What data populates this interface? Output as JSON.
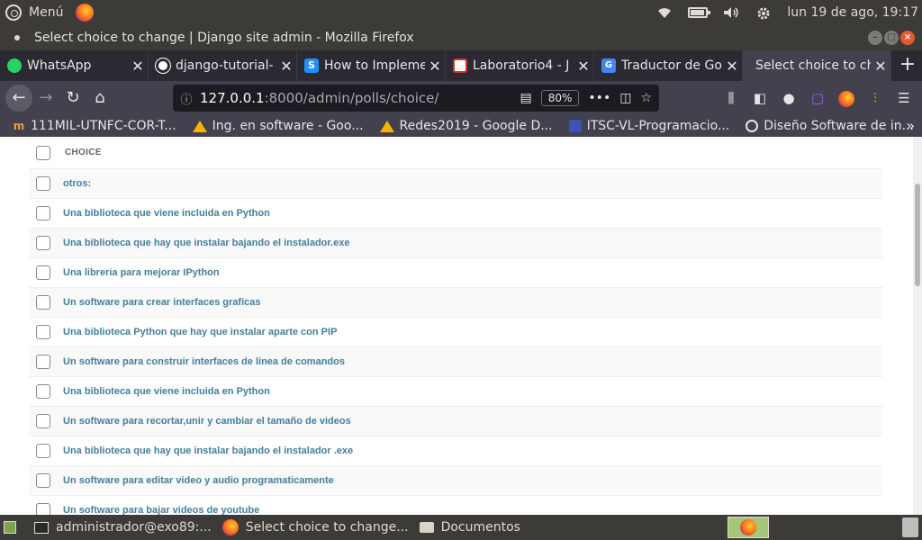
{
  "top_panel": {
    "menu_label": "Menú",
    "clock": "lun 19 de ago, 19:17"
  },
  "window": {
    "title": "Select choice to change | Django site admin - Mozilla Firefox"
  },
  "tabs": [
    {
      "label": "WhatsApp",
      "icon": "whatsapp-icon"
    },
    {
      "label": "django-tutorial-",
      "icon": "github-icon"
    },
    {
      "label": "How to Impleme",
      "icon": "stackoverflow-icon"
    },
    {
      "label": "Laboratorio4 - J",
      "icon": "gmail-icon"
    },
    {
      "label": "Traductor de Go",
      "icon": "google-translate-icon"
    },
    {
      "label": "Select choice to cha",
      "icon": "",
      "active": true
    }
  ],
  "navbar": {
    "url_host": "127.0.0.1",
    "url_path": ":8000/admin/polls/choice/",
    "zoom": "80%"
  },
  "bookmarks": [
    {
      "label": "111MIL-UTNFC-COR-T...",
      "icon": "moodle-icon"
    },
    {
      "label": "Ing. en software - Goo...",
      "icon": "google-drive-icon"
    },
    {
      "label": "Redes2019 - Google D...",
      "icon": "google-drive-icon"
    },
    {
      "label": "ITSC-VL-Programacio...",
      "icon": "classroom-icon"
    },
    {
      "label": "Diseño Software de in...",
      "icon": "globe-icon"
    }
  ],
  "table": {
    "column_header": "CHOICE",
    "rows": [
      "otros:",
      "Una biblioteca que viene incluida en Python",
      "Una biblioteca que hay que instalar bajando el instalador.exe",
      "Una libreria para mejorar IPython",
      "Un software para crear interfaces graficas",
      "Una biblioteca Python que hay que instalar aparte con PIP",
      "Un software para construir interfaces de linea de comandos",
      "Una biblioteca que viene incluida en Python",
      "Un software para recortar,unir y cambiar el tamaño de videos",
      "Una biblioteca que hay que instalar bajando el instalador .exe",
      "Un software para editar video y audio programaticamente",
      "Un software para bajar videos de youtube"
    ]
  },
  "taskbar": [
    {
      "label": "administrador@exo89:...",
      "icon": "terminal-icon"
    },
    {
      "label": "Select choice to change...",
      "icon": "firefox-icon"
    },
    {
      "label": "Documentos",
      "icon": "folder-icon"
    }
  ],
  "colors": {
    "link": "#447e9b",
    "panel": "#3c3b37",
    "toolbar": "#42414d"
  }
}
